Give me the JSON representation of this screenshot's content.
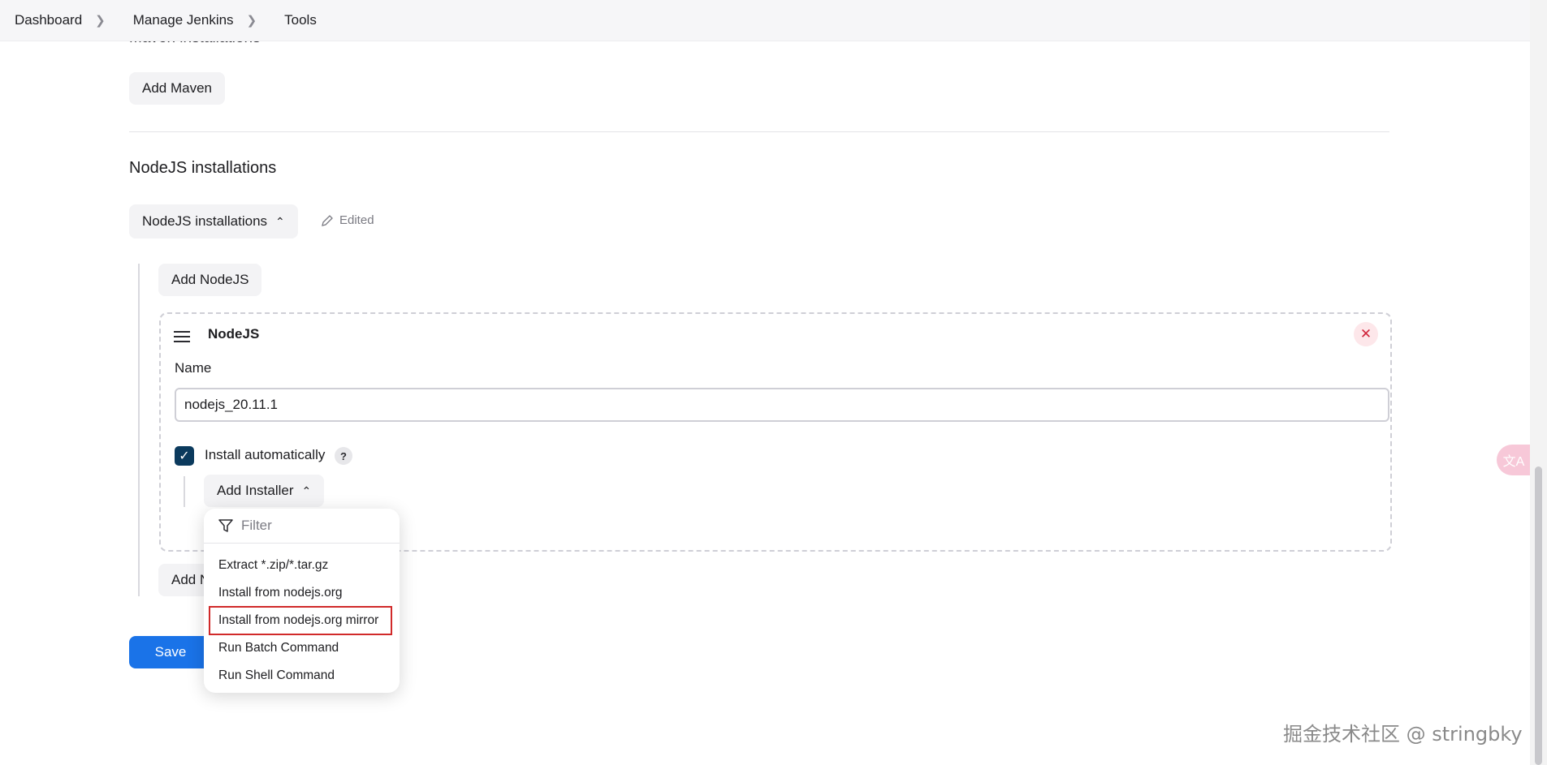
{
  "breadcrumb": [
    "Dashboard",
    "Manage Jenkins",
    "Tools"
  ],
  "maven": {
    "section_title_cut": "Maven installations",
    "add_button": "Add Maven"
  },
  "nodejs": {
    "section_title": "NodeJS installations",
    "toggle_label": "NodeJS installations",
    "edited_label": "Edited",
    "add_button": "Add NodeJS",
    "add_button_bottom": "Add NodeJS",
    "card": {
      "title": "NodeJS",
      "name_label": "Name",
      "name_value": "nodejs_20.11.1",
      "install_auto_label": "Install automatically",
      "install_auto_checked": true,
      "help": "?",
      "add_installer": "Add Installer"
    }
  },
  "installer_menu": {
    "filter_placeholder": "Filter",
    "items": [
      "Extract *.zip/*.tar.gz",
      "Install from nodejs.org",
      "Install from nodejs.org mirror",
      "Run Batch Command",
      "Run Shell Command"
    ],
    "highlighted_index": 2
  },
  "save_button": "Save",
  "watermark": "掘金技术社区 @ stringbky",
  "colors": {
    "primary": "#1a73e8",
    "checkbox": "#0b3a5d",
    "highlight_outline": "#d12a2a",
    "close_bg": "#fde7ea"
  }
}
